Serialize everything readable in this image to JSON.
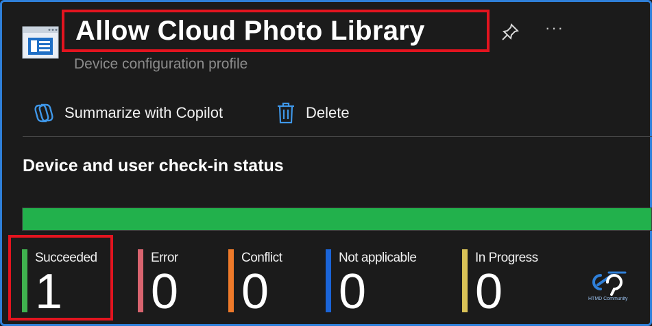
{
  "header": {
    "title": "Allow Cloud Photo Library",
    "subtitle": "Device configuration profile"
  },
  "toolbar": {
    "copilot_label": "Summarize with Copilot",
    "delete_label": "Delete"
  },
  "section": {
    "title": "Device and user check-in status"
  },
  "progress": {
    "succeeded_fraction": 1.0,
    "color": "#22b14c"
  },
  "stats": [
    {
      "label": "Succeeded",
      "value": "1",
      "color": "#3fb24f"
    },
    {
      "label": "Error",
      "value": "0",
      "color": "#d9646f"
    },
    {
      "label": "Conflict",
      "value": "0",
      "color": "#ee7a2a"
    },
    {
      "label": "Not applicable",
      "value": "0",
      "color": "#1a64d8"
    },
    {
      "label": "In Progress",
      "value": "0",
      "color": "#d9c257"
    }
  ],
  "logo": {
    "text": "HTMD Community"
  },
  "colors": {
    "highlight": "#e3141f",
    "frame": "#2f7fd8",
    "background": "#1b1b1b"
  }
}
